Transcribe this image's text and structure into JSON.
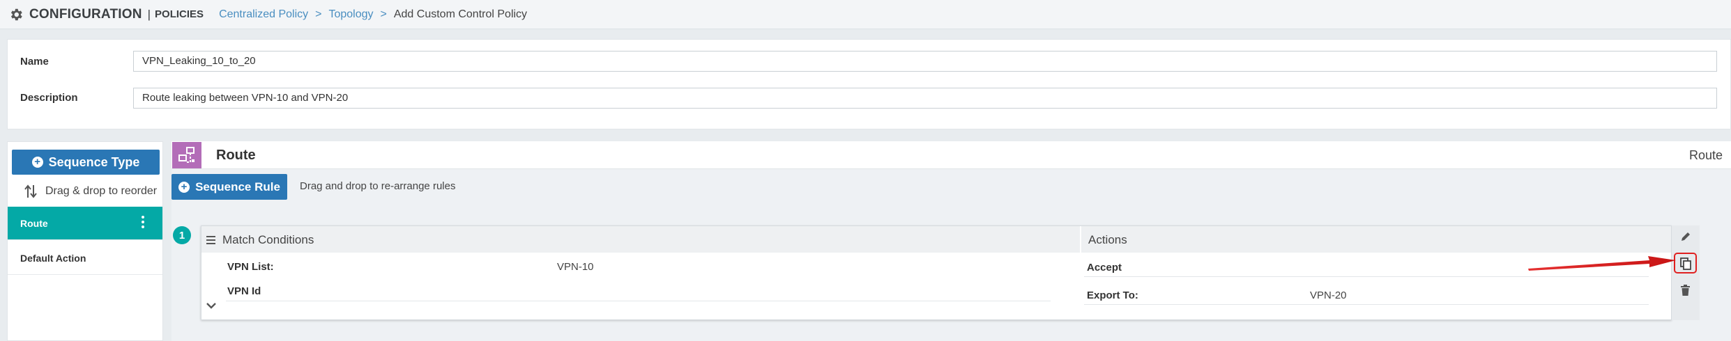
{
  "header": {
    "app_title": "CONFIGURATION",
    "separator": "|",
    "section": "POLICIES",
    "breadcrumb": [
      {
        "label": "Centralized Policy"
      },
      {
        "label": "Topology"
      },
      {
        "label": "Add Custom Control Policy"
      }
    ],
    "breadcrumb_arrow": ">"
  },
  "form": {
    "name_label": "Name",
    "name_value": "VPN_Leaking_10_to_20",
    "description_label": "Description",
    "description_value": "Route leaking between VPN-10 and VPN-20"
  },
  "sidebar": {
    "sequence_type_label": "Sequence Type",
    "drag_hint": "Drag & drop to reorder",
    "items": [
      {
        "label": "Route",
        "active": true
      },
      {
        "label": "Default Action",
        "active": false
      }
    ]
  },
  "main": {
    "title": "Route",
    "right_label": "Route",
    "sequence_rule_label": "Sequence Rule",
    "rule_hint": "Drag and drop to re-arrange rules",
    "rule": {
      "number": "1",
      "match_title": "Match Conditions",
      "actions_title": "Actions",
      "match": [
        {
          "label": "VPN List:",
          "value": "VPN-10"
        },
        {
          "label": "VPN Id",
          "value": ""
        }
      ],
      "actions": [
        {
          "label": "Accept",
          "value": ""
        },
        {
          "label": "Export To:",
          "value": "VPN-20"
        }
      ]
    }
  },
  "colors": {
    "primary_button": "#2a77b5",
    "active_teal": "#04a9a6",
    "route_icon_bg": "#b36db8",
    "annotation_red": "#e02020",
    "link_blue": "#4a8ec0"
  },
  "icons": [
    "gear-icon",
    "plus-circle-icon",
    "reorder-arrows-icon",
    "kebab-menu-icon",
    "route-policy-icon",
    "hamburger-icon",
    "chevron-down-icon",
    "edit-pencil-icon",
    "copy-icon",
    "trash-icon",
    "annotation-arrow"
  ]
}
